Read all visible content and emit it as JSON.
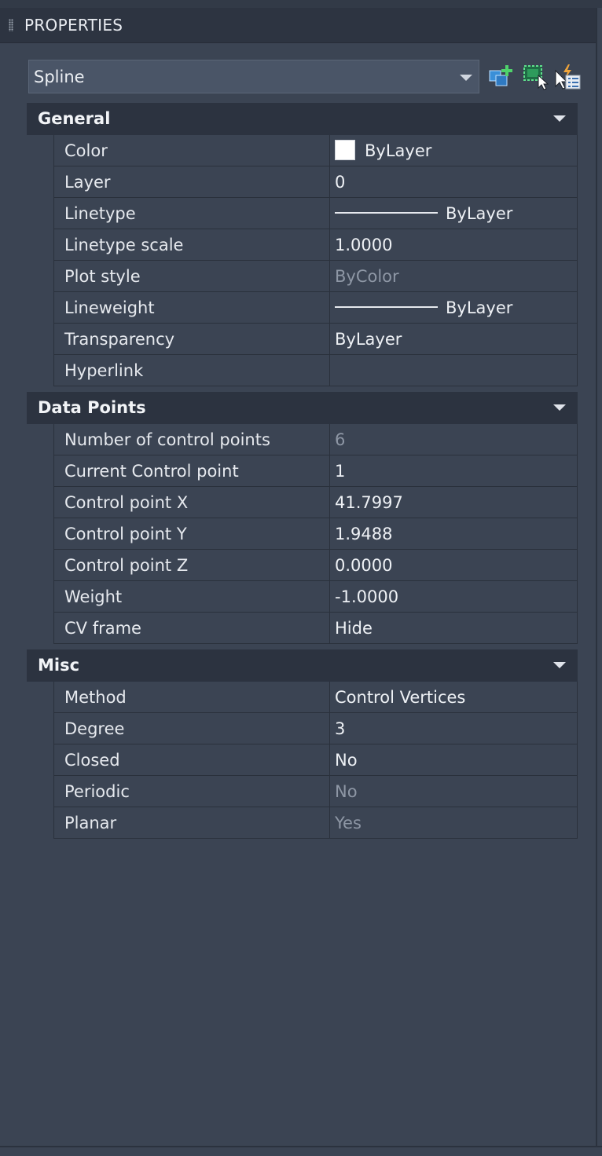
{
  "panel": {
    "title": "PROPERTIES"
  },
  "selector": {
    "value": "Spline"
  },
  "toolbar": {
    "quick_select": "quick-select-icon",
    "select_objects": "select-objects-icon",
    "toggle_pickadd": "toggle-pickadd-icon"
  },
  "sections": {
    "general": {
      "title": "General",
      "rows": [
        {
          "name": "Color",
          "value": "ByLayer"
        },
        {
          "name": "Layer",
          "value": "0"
        },
        {
          "name": "Linetype",
          "value": "ByLayer"
        },
        {
          "name": "Linetype scale",
          "value": "1.0000"
        },
        {
          "name": "Plot style",
          "value": "ByColor"
        },
        {
          "name": "Lineweight",
          "value": "ByLayer"
        },
        {
          "name": "Transparency",
          "value": "ByLayer"
        },
        {
          "name": "Hyperlink",
          "value": ""
        }
      ]
    },
    "data_points": {
      "title": "Data Points",
      "rows": [
        {
          "name": "Number of control points",
          "value": "6"
        },
        {
          "name": "Current Control point",
          "value": "1"
        },
        {
          "name": "Control point X",
          "value": "41.7997"
        },
        {
          "name": "Control point Y",
          "value": "1.9488"
        },
        {
          "name": "Control point Z",
          "value": "0.0000"
        },
        {
          "name": "Weight",
          "value": "-1.0000"
        },
        {
          "name": "CV frame",
          "value": "Hide"
        }
      ]
    },
    "misc": {
      "title": "Misc",
      "rows": [
        {
          "name": "Method",
          "value": "Control Vertices"
        },
        {
          "name": "Degree",
          "value": "3"
        },
        {
          "name": "Closed",
          "value": "No"
        },
        {
          "name": "Periodic",
          "value": "No"
        },
        {
          "name": "Planar",
          "value": "Yes"
        }
      ]
    }
  }
}
